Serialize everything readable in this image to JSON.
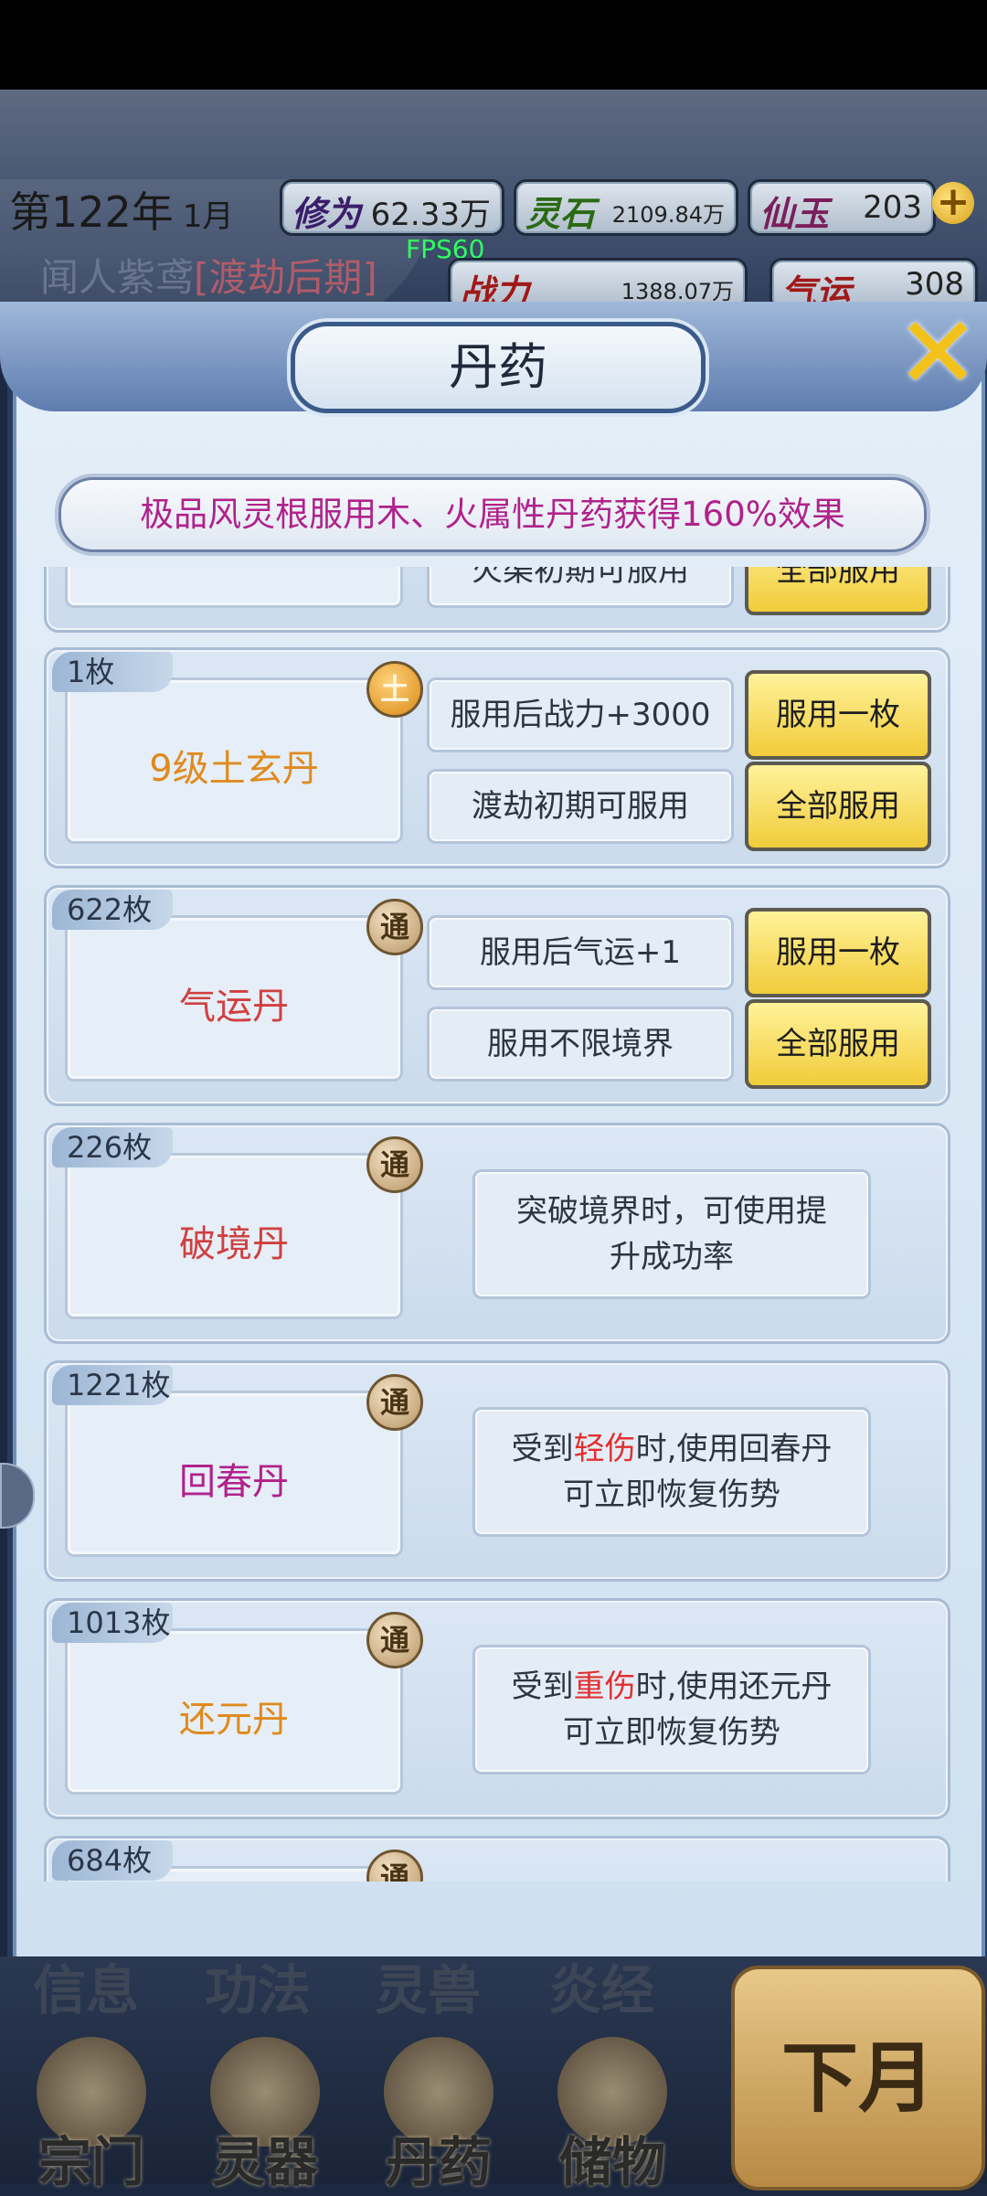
{
  "header": {
    "year": "第122年",
    "month": "1月",
    "xiuwei_label": "修为",
    "xiuwei_value": "62.33万",
    "lingshi_label": "灵石",
    "lingshi_value": "2109.84万",
    "xianyu_label": "仙玉",
    "xianyu_value": "203",
    "plus": "+",
    "player_name": "闻人紫鸢",
    "player_rank": "[渡劫后期]",
    "fps": "FPS60",
    "zhanli_label": "战力",
    "zhanli_value": "1388.07万",
    "qiyun_label": "气运",
    "qiyun_value": "308"
  },
  "panel": {
    "title": "丹药",
    "close": "✕",
    "notice": "极品风灵根服用木、火属性丹药获得160%效果"
  },
  "partial_row": {
    "info": "火渠初期可服用",
    "btn": "全部服用"
  },
  "items": [
    {
      "count": "1枚",
      "badge": "土",
      "name": "9级土玄丹",
      "color": "#e08a1e",
      "info1": "服用后战力+3000",
      "info2": "渡劫初期可服用",
      "btn1": "服用一枚",
      "btn2": "全部服用"
    },
    {
      "count": "622枚",
      "badge": "通",
      "name": "气运丹",
      "color": "#d04040",
      "info1": "服用后气运+1",
      "info2": "服用不限境界",
      "btn1": "服用一枚",
      "btn2": "全部服用"
    },
    {
      "count": "226枚",
      "badge": "通",
      "name": "破境丹",
      "color": "#d04040",
      "desc1": "突破境界时，可使用提",
      "desc2": "升成功率"
    },
    {
      "count": "1221枚",
      "badge": "通",
      "name": "回春丹",
      "color": "#b0228c",
      "desc_pre": "受到",
      "desc_hl": "轻伤",
      "desc_post": "时,使用回春丹",
      "desc2": "可立即恢复伤势"
    },
    {
      "count": "1013枚",
      "badge": "通",
      "name": "还元丹",
      "color": "#e08a1e",
      "desc_pre": "受到",
      "desc_hl": "重伤",
      "desc_post": "时,使用还元丹",
      "desc2": "可立即恢复伤势"
    },
    {
      "count": "684枚",
      "badge": "通"
    }
  ],
  "nav": {
    "top": [
      "信息",
      "功法",
      "灵兽",
      "炎经"
    ],
    "bottom": [
      "宗门",
      "灵器",
      "丹药",
      "储物"
    ],
    "next_month": "下月"
  }
}
